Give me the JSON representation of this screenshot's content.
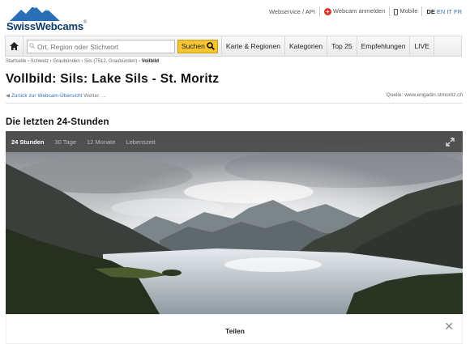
{
  "logo": {
    "text": "SwissWebcams",
    "reg": "®"
  },
  "toplinks": {
    "webservice": "Webservice / API",
    "register": "Webcam anmelden",
    "mobile": "Mobile",
    "lang_active": "DE",
    "lang_en": "EN",
    "lang_it": "IT",
    "lang_fr": "FR"
  },
  "nav": {
    "search_placeholder": "Ort, Region oder Stichwort",
    "search_button": "Suchen",
    "items": [
      "Karte & Regionen",
      "Kategorien",
      "Top 25",
      "Empfehlungen",
      "LIVE"
    ]
  },
  "breadcrumb": {
    "path": "Startseite › Schweiz › Graubünden › Sils (7512, Graubünden) ›",
    "current": "Vollbild"
  },
  "page_title": "Vollbild: Sils: Lake Sils - St. Moritz",
  "back_link": "Zurück zur Webcam-Übersicht",
  "weather_link": "Wetter, ...",
  "source": "Quelle: www.engadin.stmoritz.ch",
  "section_title": "Die letzten 24-Stunden",
  "viewer": {
    "tabs": [
      "24 Stunden",
      "30 Tage",
      "12 Monate",
      "Lebenszeit"
    ],
    "active_tab": 0
  },
  "footer": {
    "share": "Teilen",
    "close": "✕"
  },
  "colors": {
    "accent": "#f4c431",
    "link": "#3a6fb5",
    "brand": "#0d3b66"
  }
}
